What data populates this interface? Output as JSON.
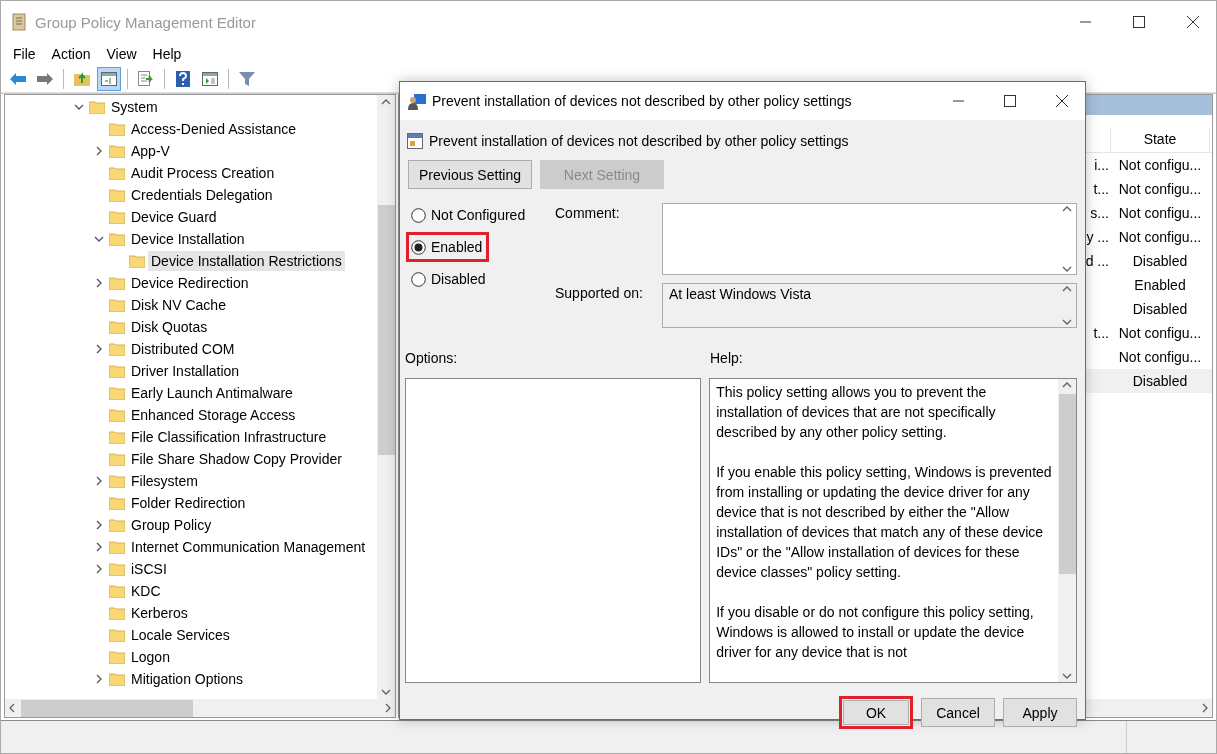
{
  "window": {
    "title": "Group Policy Management Editor"
  },
  "menu": [
    "File",
    "Action",
    "View",
    "Help"
  ],
  "toolbar": [
    {
      "kind": "back",
      "pressed": false
    },
    {
      "kind": "forward",
      "pressed": false
    },
    {
      "kind": "separator"
    },
    {
      "kind": "up",
      "pressed": false
    },
    {
      "kind": "tree",
      "pressed": true
    },
    {
      "kind": "separator"
    },
    {
      "kind": "export",
      "pressed": false
    },
    {
      "kind": "separator"
    },
    {
      "kind": "help",
      "pressed": false
    },
    {
      "kind": "pane",
      "pressed": false
    },
    {
      "kind": "separator"
    },
    {
      "kind": "filter",
      "pressed": false
    }
  ],
  "tree": [
    {
      "label": "System",
      "expandable": true,
      "expanded": true,
      "selected": false,
      "children": [
        {
          "label": "Access-Denied Assistance",
          "expandable": false,
          "expanded": false,
          "selected": false
        },
        {
          "label": "App-V",
          "expandable": true,
          "expanded": false,
          "selected": false
        },
        {
          "label": "Audit Process Creation",
          "expandable": false,
          "expanded": false,
          "selected": false
        },
        {
          "label": "Credentials Delegation",
          "expandable": false,
          "expanded": false,
          "selected": false
        },
        {
          "label": "Device Guard",
          "expandable": false,
          "expanded": false,
          "selected": false
        },
        {
          "label": "Device Installation",
          "expandable": true,
          "expanded": true,
          "selected": false,
          "children": [
            {
              "label": "Device Installation Restrictions",
              "expandable": false,
              "expanded": false,
              "selected": true
            }
          ]
        },
        {
          "label": "Device Redirection",
          "expandable": true,
          "expanded": false,
          "selected": false
        },
        {
          "label": "Disk NV Cache",
          "expandable": false,
          "expanded": false,
          "selected": false
        },
        {
          "label": "Disk Quotas",
          "expandable": false,
          "expanded": false,
          "selected": false
        },
        {
          "label": "Distributed COM",
          "expandable": true,
          "expanded": false,
          "selected": false
        },
        {
          "label": "Driver Installation",
          "expandable": false,
          "expanded": false,
          "selected": false
        },
        {
          "label": "Early Launch Antimalware",
          "expandable": false,
          "expanded": false,
          "selected": false
        },
        {
          "label": "Enhanced Storage Access",
          "expandable": false,
          "expanded": false,
          "selected": false
        },
        {
          "label": "File Classification Infrastructure",
          "expandable": false,
          "expanded": false,
          "selected": false
        },
        {
          "label": "File Share Shadow Copy Provider",
          "expandable": false,
          "expanded": false,
          "selected": false
        },
        {
          "label": "Filesystem",
          "expandable": true,
          "expanded": false,
          "selected": false
        },
        {
          "label": "Folder Redirection",
          "expandable": false,
          "expanded": false,
          "selected": false
        },
        {
          "label": "Group Policy",
          "expandable": true,
          "expanded": false,
          "selected": false
        },
        {
          "label": "Internet Communication Management",
          "expandable": true,
          "expanded": false,
          "selected": false
        },
        {
          "label": "iSCSI",
          "expandable": true,
          "expanded": false,
          "selected": false
        },
        {
          "label": "KDC",
          "expandable": false,
          "expanded": false,
          "selected": false
        },
        {
          "label": "Kerberos",
          "expandable": false,
          "expanded": false,
          "selected": false
        },
        {
          "label": "Locale Services",
          "expandable": false,
          "expanded": false,
          "selected": false
        },
        {
          "label": "Logon",
          "expandable": false,
          "expanded": false,
          "selected": false
        },
        {
          "label": "Mitigation Options",
          "expandable": true,
          "expanded": false,
          "selected": false
        }
      ]
    }
  ],
  "settings_list": {
    "columns": [
      "State"
    ],
    "rows": [
      {
        "column_1": "i...",
        "state": "Not configu...",
        "selected": false
      },
      {
        "column_1": "t...",
        "state": "Not configu...",
        "selected": false
      },
      {
        "column_1": "s...",
        "state": "Not configu...",
        "selected": false
      },
      {
        "column_1": "y ...",
        "state": "Not configu...",
        "selected": false
      },
      {
        "column_1": "d ...",
        "state": "Disabled",
        "selected": false
      },
      {
        "state": "Enabled",
        "selected": false
      },
      {
        "state": "Disabled",
        "selected": false
      },
      {
        "column_1": "t...",
        "state": "Not configu...",
        "selected": false
      },
      {
        "state": "Not configu...",
        "selected": false
      },
      {
        "state": "Disabled",
        "selected": true
      }
    ]
  },
  "dialog": {
    "title": "Prevent installation of devices not described by other policy settings",
    "heading": "Prevent installation of devices not described by other policy settings",
    "nav_buttons": [
      {
        "label": "Previous Setting",
        "disabled": false
      },
      {
        "label": "Next Setting",
        "disabled": true
      }
    ],
    "options": [
      {
        "label": "Not Configured",
        "selected": false,
        "highlighted": false
      },
      {
        "label": "Enabled",
        "selected": true,
        "highlighted": true
      },
      {
        "label": "Disabled",
        "selected": false,
        "highlighted": false
      }
    ],
    "comment_label": "Comment:",
    "supported_label": "Supported on:",
    "supported_value": "At least Windows Vista",
    "options_label": "Options:",
    "help_label": "Help:",
    "help": [
      "This policy setting allows you to prevent the installation of devices that are not specifically described by any other policy setting.",
      "If you enable this policy setting, Windows is prevented from installing or updating the device driver for any device that is not described by either the \"Allow installation of devices that match any of these device IDs\" or the \"Allow installation of devices for these device classes\" policy setting.",
      "If you disable or do not configure this policy setting, Windows is allowed to install or update the device driver for any device that is not"
    ],
    "buttons": [
      {
        "label": "OK",
        "highlighted": true
      },
      {
        "label": "Cancel",
        "highlighted": false
      },
      {
        "label": "Apply",
        "highlighted": false
      }
    ]
  }
}
